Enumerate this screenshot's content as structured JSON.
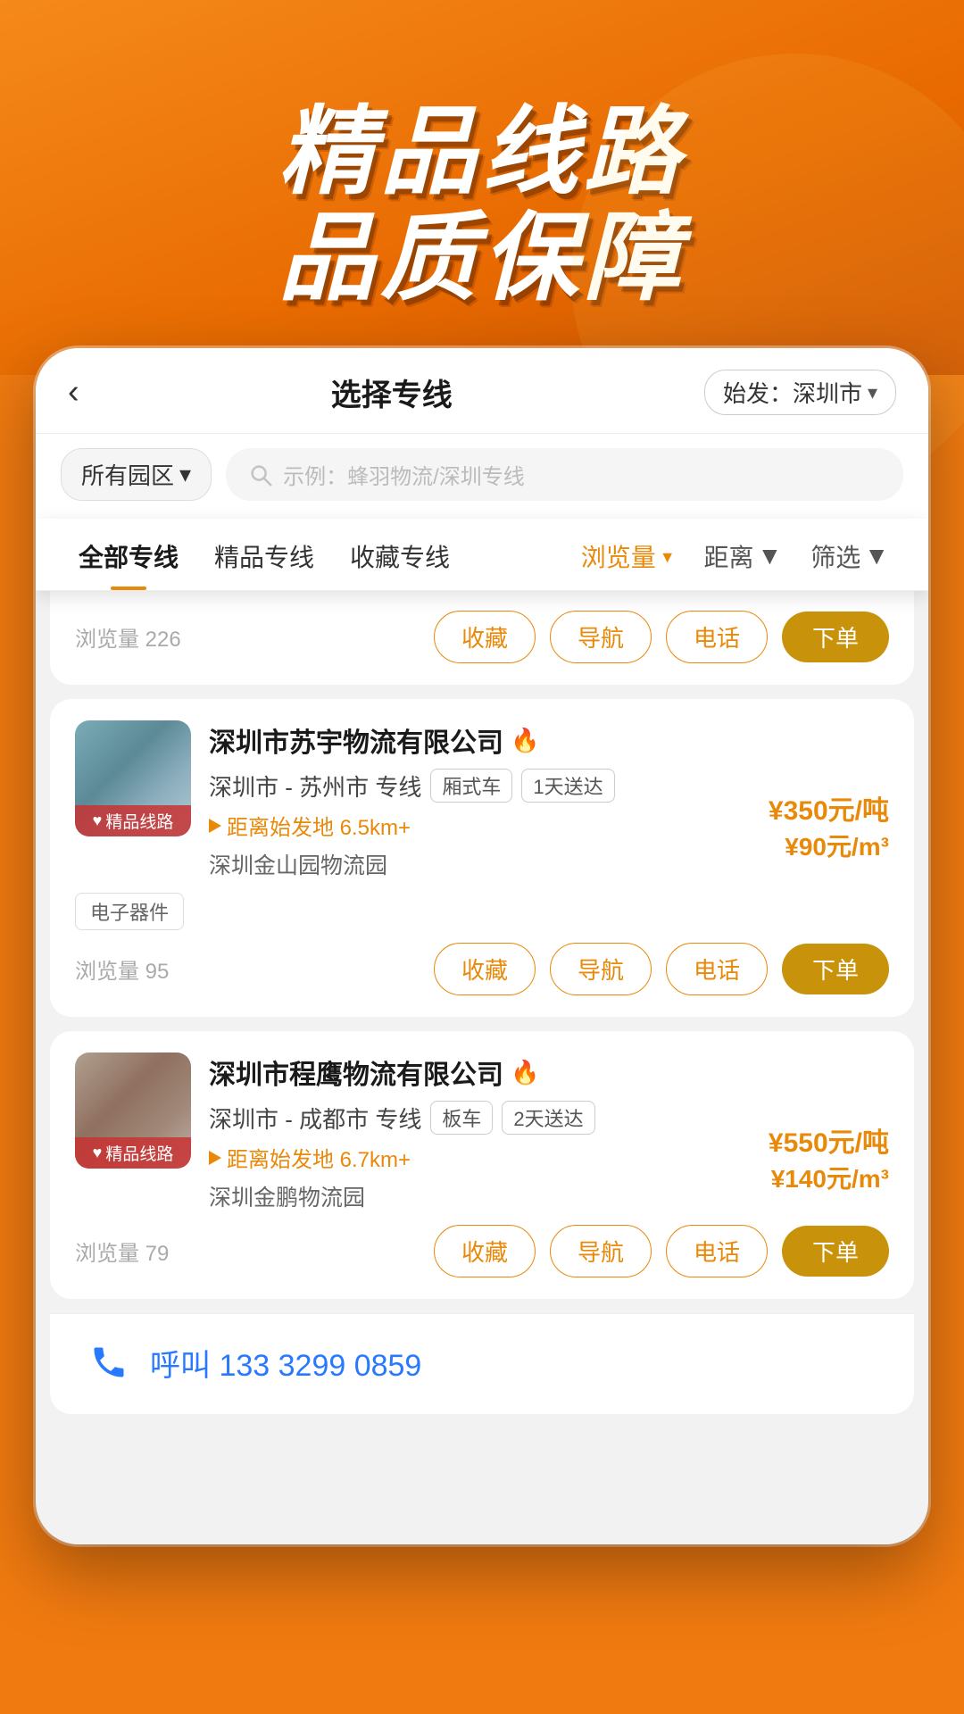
{
  "hero": {
    "title1": "精品线路",
    "title2": "品质保障"
  },
  "topbar": {
    "back_label": "‹",
    "title": "选择专线",
    "badge_label": "始发：深圳市",
    "badge_chevron": "▾"
  },
  "search": {
    "district": "所有园区",
    "district_chevron": "▾",
    "placeholder": "示例：蜂羽物流/深圳专线"
  },
  "tabs": [
    {
      "label": "全部专线",
      "active": true
    },
    {
      "label": "精品专线",
      "active": false
    },
    {
      "label": "收藏专线",
      "active": false
    }
  ],
  "sort_tabs": [
    {
      "label": "浏览量",
      "active": true,
      "suffix": "▼"
    },
    {
      "label": "距离",
      "active": false,
      "suffix": "▼"
    },
    {
      "label": "筛选",
      "active": false,
      "suffix": "▼"
    }
  ],
  "cards": [
    {
      "company": "深圳市苏宇物流有限公司",
      "hot": true,
      "route_from": "深圳市",
      "route_to": "苏州市",
      "route_type": "专线",
      "tags": [
        "厢式车",
        "1天送达"
      ],
      "distance": "距离始发地  6.5km+",
      "location": "深圳金山园物流园",
      "goods_tag": "电子器件",
      "price_ton": "¥350元/吨",
      "price_m3": "¥90元/m³",
      "views": "浏览量 95",
      "badge": "♥ 精品线路",
      "actions": [
        "收藏",
        "导航",
        "电话",
        "下单"
      ]
    },
    {
      "company": "深圳市程鹰物流有限公司",
      "hot": true,
      "route_from": "深圳市",
      "route_to": "成都市",
      "route_type": "专线",
      "tags": [
        "板车",
        "2天送达"
      ],
      "distance": "距离始发地  6.7km+",
      "location": "深圳金鹏物流园",
      "goods_tag": "",
      "price_ton": "¥550元/吨",
      "price_m3": "¥140元/m³",
      "views": "浏览量 79",
      "badge": "♥ 精品线路",
      "actions": [
        "收藏",
        "导航",
        "电话",
        "下单"
      ]
    }
  ],
  "prev_views": "浏览量 226",
  "prev_actions": [
    "收藏",
    "导航",
    "电话",
    "下单"
  ],
  "bottom": {
    "call_label": "呼叫 133 3299 0859"
  }
}
